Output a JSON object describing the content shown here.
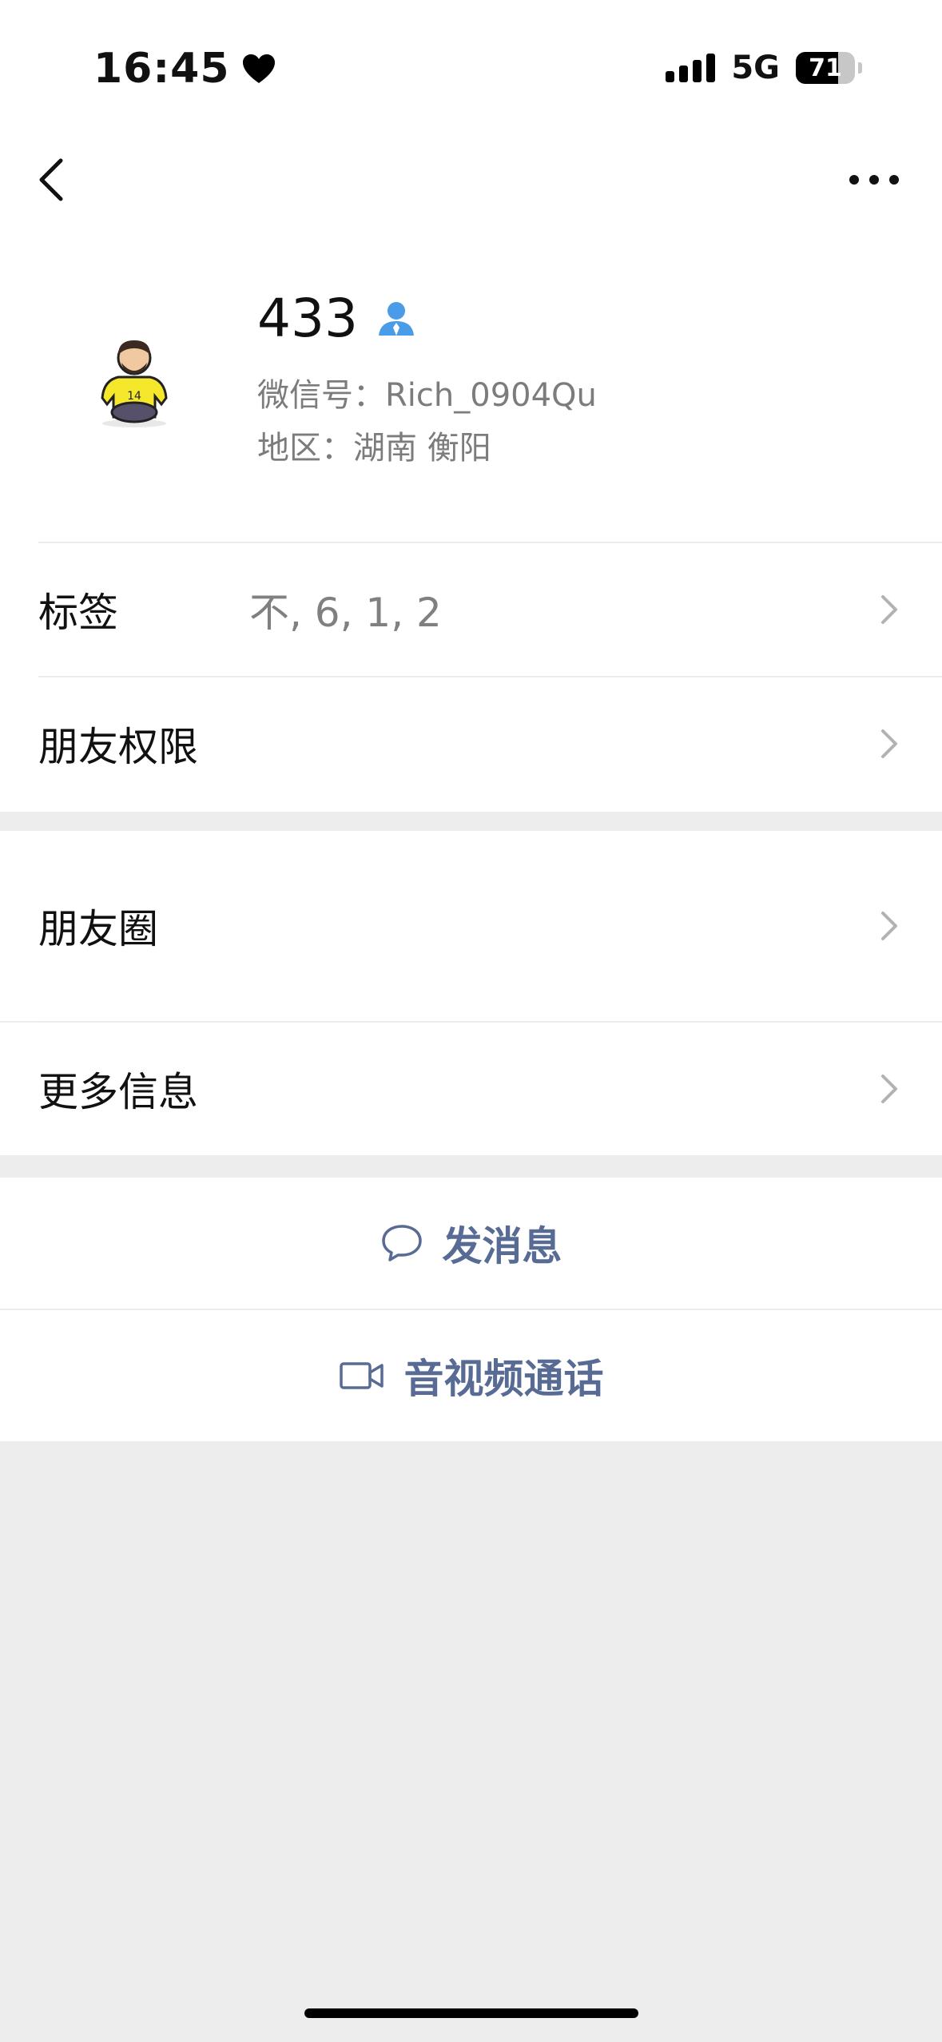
{
  "status_bar": {
    "time": "16:45",
    "network": "5G",
    "battery_level": "71",
    "battery_fraction": 0.71,
    "icons": [
      "heart-icon",
      "signal-icon",
      "battery-icon"
    ]
  },
  "nav": {
    "back_icon": "chevron-left-icon",
    "more_icon": "more-horizontal-icon"
  },
  "profile": {
    "name": "433",
    "wechat_id": "微信号：Rich_0904Qu",
    "region": "地区：湖南 衡阳",
    "verified_icon": "person-icon"
  },
  "rows": [
    {
      "label": "标签",
      "value": "不, 6, 1, 2"
    },
    {
      "label": "朋友权限",
      "value": ""
    },
    {
      "label": "朋友圈",
      "value": ""
    },
    {
      "label": "更多信息",
      "value": ""
    }
  ],
  "actions": {
    "message": {
      "label": "发消息",
      "icon": "chat-bubble-icon"
    },
    "call": {
      "label": "音视频通话",
      "icon": "video-camera-icon"
    }
  },
  "colors": {
    "accent": "#576b95",
    "verified_blue": "#4a9be8",
    "background": "#ededed"
  }
}
